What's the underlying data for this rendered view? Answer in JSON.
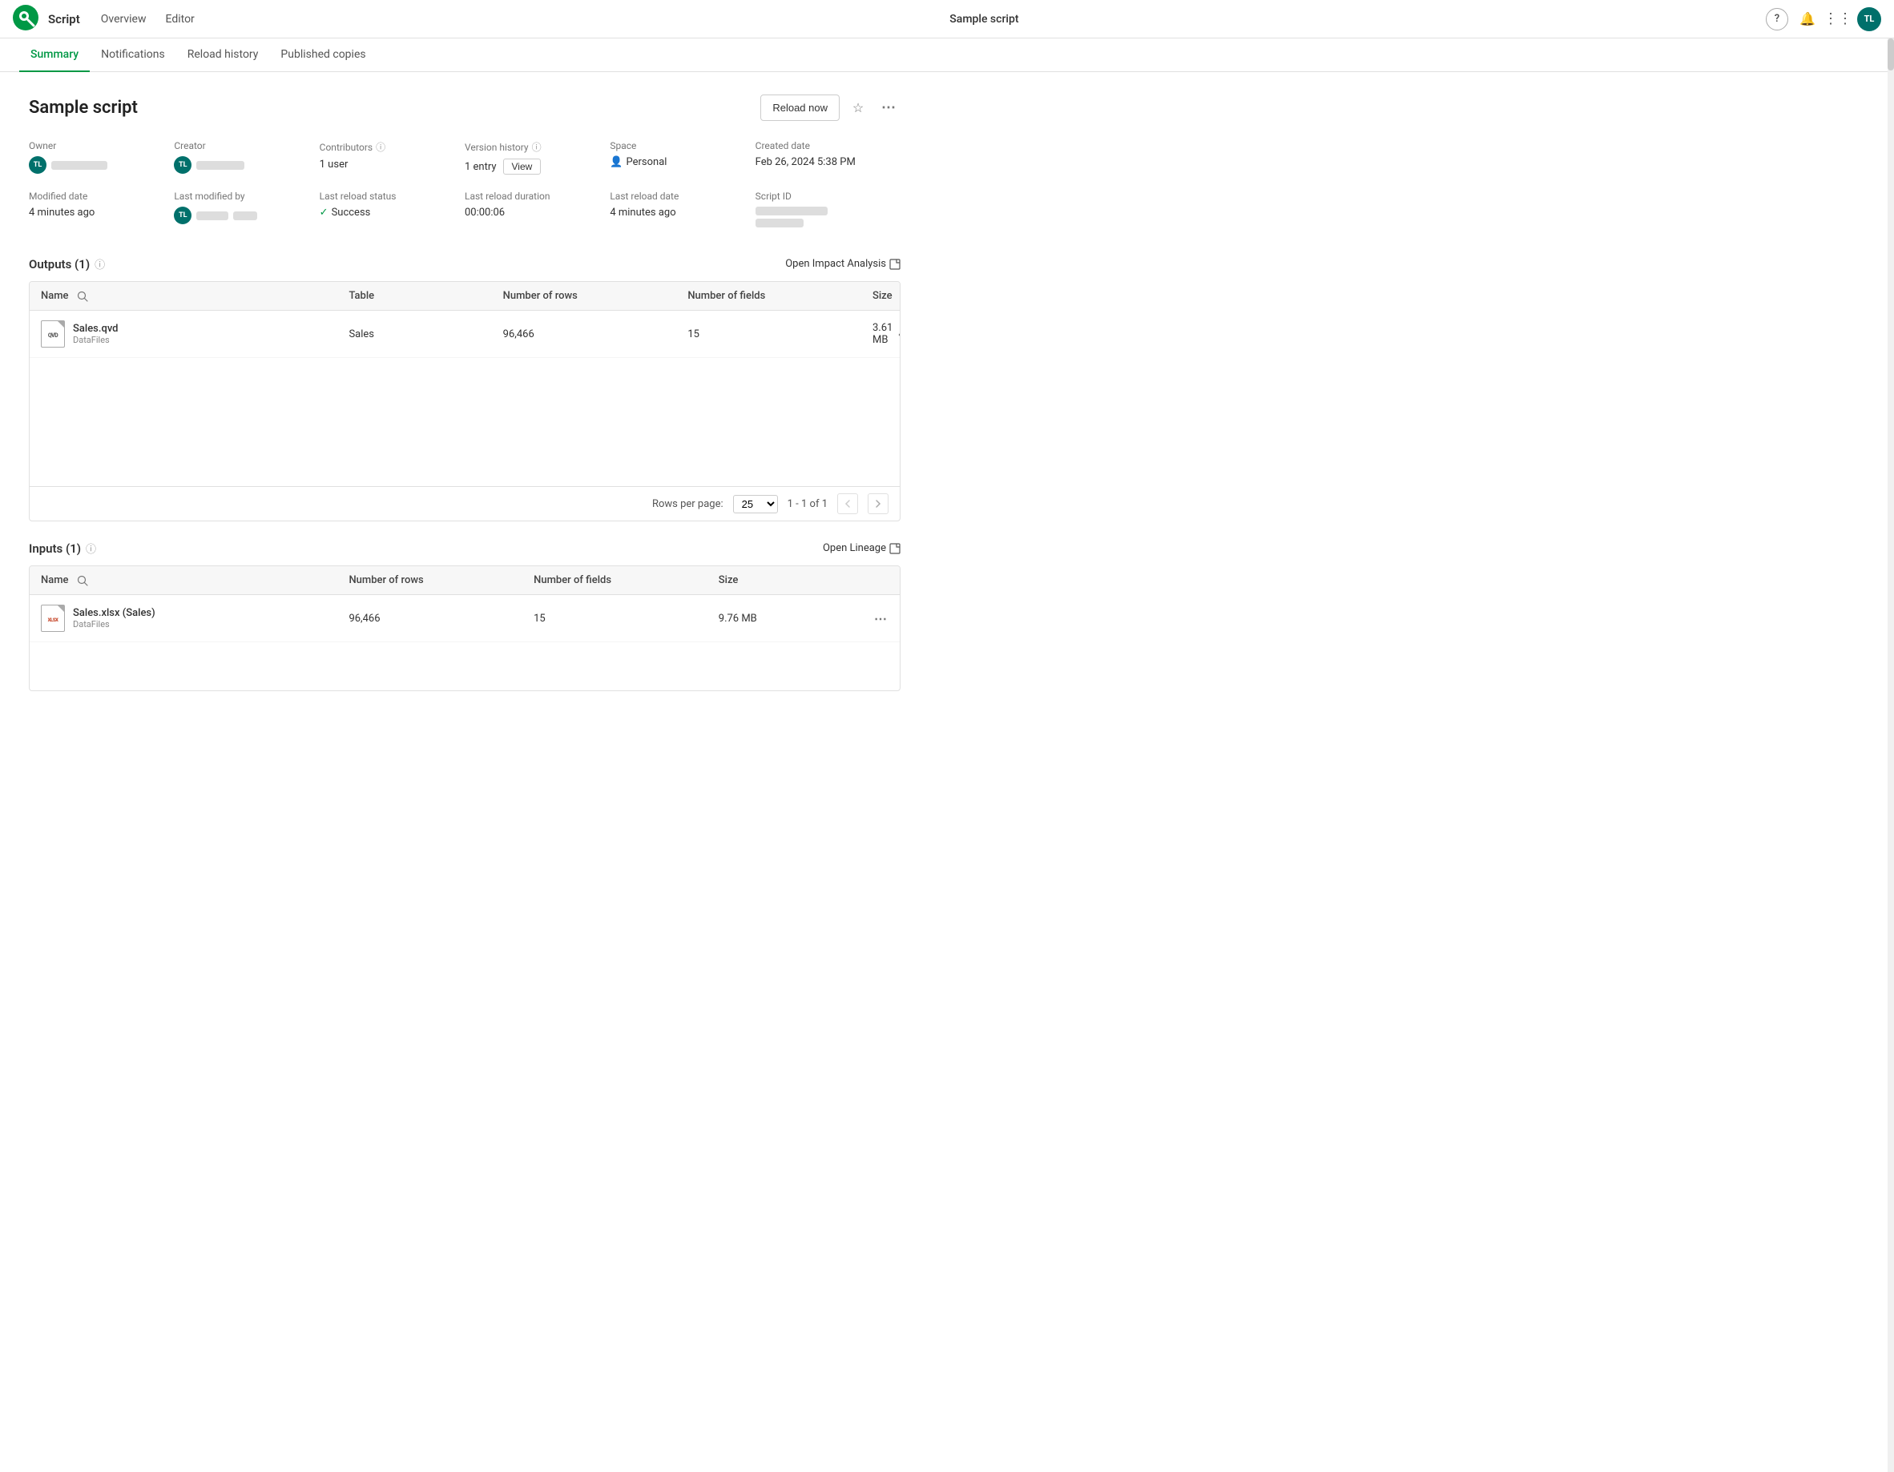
{
  "topNav": {
    "logoAlt": "Qlik",
    "appName": "Script",
    "links": [
      {
        "id": "overview",
        "label": "Overview"
      },
      {
        "id": "editor",
        "label": "Editor"
      }
    ],
    "centerTitle": "Sample script",
    "helpIcon": "?",
    "bellIcon": "🔔",
    "gridIcon": "⋮⋮⋮",
    "avatarText": "TL"
  },
  "tabs": [
    {
      "id": "summary",
      "label": "Summary",
      "active": true
    },
    {
      "id": "notifications",
      "label": "Notifications",
      "active": false
    },
    {
      "id": "reload-history",
      "label": "Reload history",
      "active": false
    },
    {
      "id": "published-copies",
      "label": "Published copies",
      "active": false
    }
  ],
  "pageTitle": "Sample script",
  "reloadButton": "Reload now",
  "meta": {
    "owner": {
      "label": "Owner",
      "avatarText": "TL"
    },
    "creator": {
      "label": "Creator",
      "avatarText": "TL"
    },
    "contributors": {
      "label": "Contributors",
      "value": "1 user",
      "infoIcon": true
    },
    "versionHistory": {
      "label": "Version history",
      "value": "1 entry",
      "viewLabel": "View",
      "infoIcon": true
    },
    "space": {
      "label": "Space",
      "value": "Personal"
    },
    "createdDate": {
      "label": "Created date",
      "value": "Feb 26, 2024 5:38 PM"
    },
    "modifiedDate": {
      "label": "Modified date",
      "value": "4 minutes ago"
    },
    "lastModifiedBy": {
      "label": "Last modified by",
      "avatarText": "TL"
    },
    "lastReloadStatus": {
      "label": "Last reload status",
      "value": "Success",
      "checkmark": "✓"
    },
    "lastReloadDuration": {
      "label": "Last reload duration",
      "value": "00:00:06"
    },
    "lastReloadDate": {
      "label": "Last reload date",
      "value": "4 minutes ago"
    },
    "scriptId": {
      "label": "Script ID"
    }
  },
  "outputs": {
    "sectionTitle": "Outputs (1)",
    "openAnalysisLabel": "Open Impact Analysis",
    "tableHeaders": {
      "name": "Name",
      "table": "Table",
      "numRows": "Number of rows",
      "numFields": "Number of fields",
      "size": "Size"
    },
    "rows": [
      {
        "fileName": "Sales.qvd",
        "fileType": "qvd",
        "fileLocation": "DataFiles",
        "table": "Sales",
        "numRows": "96,466",
        "numFields": "15",
        "size": "3.61 MB"
      }
    ],
    "footer": {
      "rowsPerPageLabel": "Rows per page:",
      "rowsPerPageValue": "25",
      "paginationInfo": "1 - 1 of 1"
    }
  },
  "inputs": {
    "sectionTitle": "Inputs (1)",
    "openLineageLabel": "Open Lineage",
    "tableHeaders": {
      "name": "Name",
      "numRows": "Number of rows",
      "numFields": "Number of fields",
      "size": "Size"
    },
    "rows": [
      {
        "fileName": "Sales.xlsx (Sales)",
        "fileType": "xlsx",
        "fileLocation": "DataFiles",
        "numRows": "96,466",
        "numFields": "15",
        "size": "9.76 MB"
      }
    ]
  }
}
